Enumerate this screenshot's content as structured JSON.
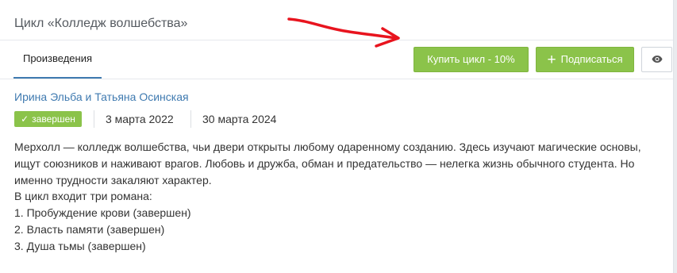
{
  "header": {
    "title": "Цикл «Колледж волшебства»"
  },
  "tabs": [
    {
      "label": "Произведения",
      "active": true
    }
  ],
  "actions": {
    "buy_label": "Купить цикл - 10%",
    "subscribe_label": "Подписаться",
    "subscribe_icon": "plus-icon",
    "view_icon": "eye-icon"
  },
  "annotation": {
    "arrow_color": "#e8141e"
  },
  "book": {
    "authors": "Ирина Эльба и Татьяна Осинская",
    "status": "завершен",
    "status_icon": "check-icon",
    "start_date": "3 марта 2022",
    "end_date": "30 марта 2024",
    "description": [
      "Мерхолл — колледж волшебства, чьи двери открыты любому одаренному созданию. Здесь изучают магические основы, ищут союзников и наживают врагов. Любовь и дружба, обман и предательство — нелегка жизнь обычного студента. Но именно трудности закаляют характер.",
      "В цикл входит три романа:",
      "1. Пробуждение крови (завершен)",
      "2. Власть памяти (завершен)",
      "3. Душа тьмы (завершен)"
    ]
  },
  "colors": {
    "accent_green": "#8bc34a",
    "link_blue": "#3f7ab0"
  }
}
